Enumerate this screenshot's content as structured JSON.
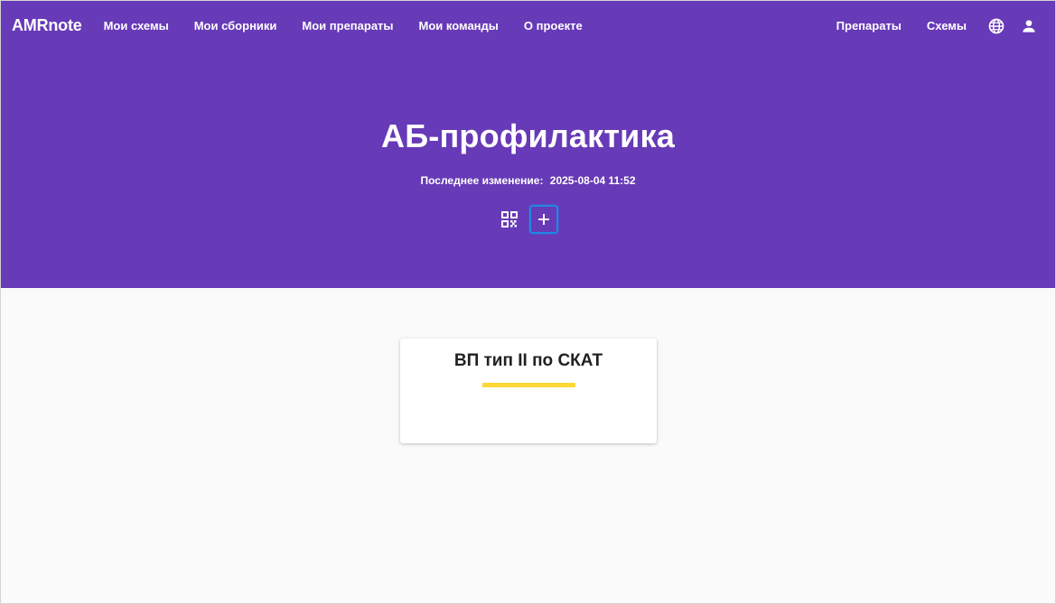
{
  "navbar": {
    "brand": "AMRnote",
    "left_links": [
      {
        "label": "Мои схемы"
      },
      {
        "label": "Мои сборники"
      },
      {
        "label": "Мои препараты"
      },
      {
        "label": "Мои команды"
      },
      {
        "label": "О проекте"
      }
    ],
    "right_links": [
      {
        "label": "Препараты"
      },
      {
        "label": "Схемы"
      }
    ],
    "icons": {
      "language": "globe-icon",
      "account": "user-icon"
    }
  },
  "hero": {
    "title": "АБ-профилактика",
    "last_modified_label": "Последнее изменение:",
    "last_modified_value": "2025-08-04 11:52",
    "actions": {
      "qr": "qr-code-icon",
      "add": "plus-icon"
    }
  },
  "cards": [
    {
      "title": "ВП тип II по СКАТ",
      "accent_color": "#fdd835"
    }
  ],
  "colors": {
    "primary": "#673ab7",
    "focus_outline": "#1e88e5",
    "background": "#fafafa"
  }
}
